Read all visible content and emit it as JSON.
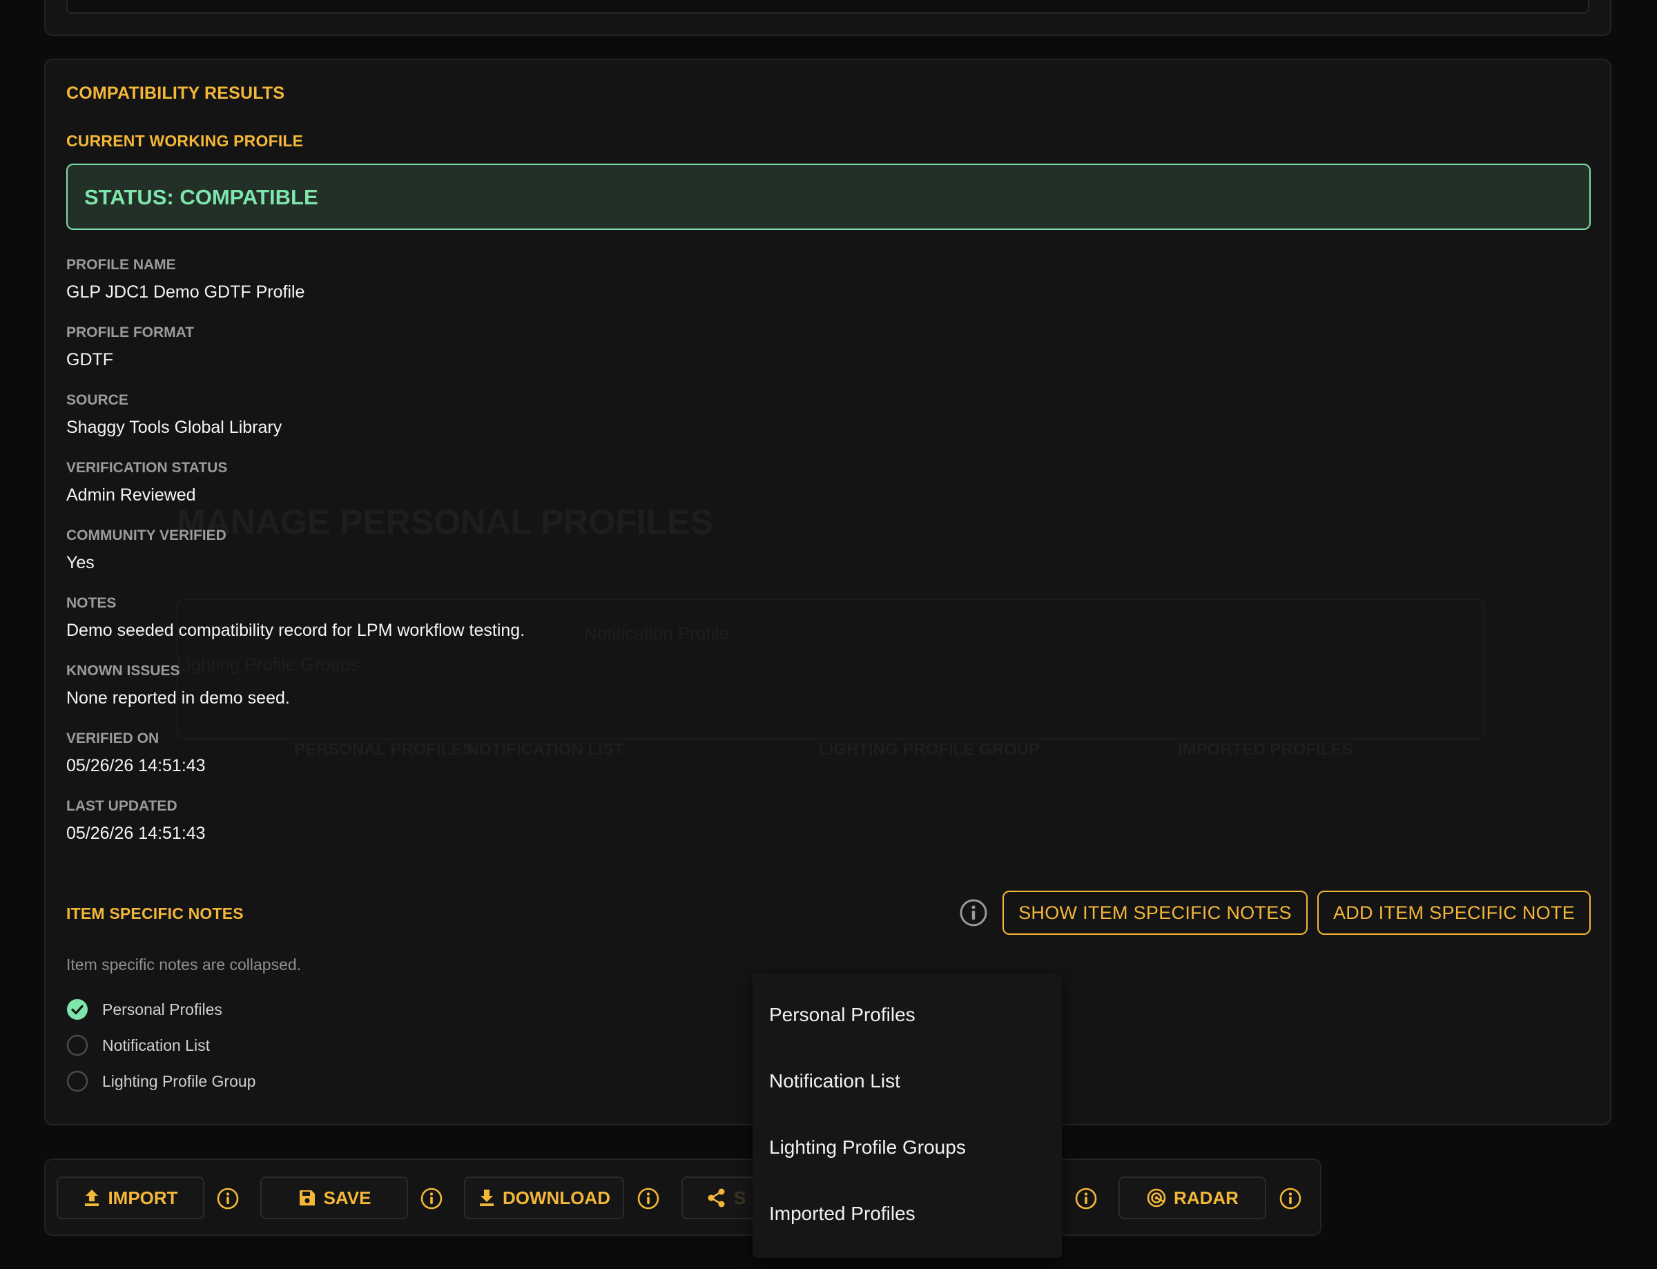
{
  "background_ghost": {
    "title": "MANAGE PERSONAL PROFILES",
    "line1": "Notification Profile",
    "line2": "Lighting Profile Groups",
    "tab1": "PERSONAL PROFILES",
    "tab2": "NOTIFICATION LIST",
    "tab3": "LIGHTING PROFILE GROUP",
    "tab4": "IMPORTED PROFILES"
  },
  "results": {
    "title": "COMPATIBILITY RESULTS",
    "working_profile_label": "CURRENT WORKING PROFILE",
    "status": "STATUS: COMPATIBLE",
    "fields": [
      {
        "label": "PROFILE NAME",
        "value": "GLP JDC1 Demo GDTF Profile"
      },
      {
        "label": "PROFILE FORMAT",
        "value": "GDTF"
      },
      {
        "label": "SOURCE",
        "value": "Shaggy Tools Global Library"
      },
      {
        "label": "VERIFICATION STATUS",
        "value": "Admin Reviewed"
      },
      {
        "label": "COMMUNITY VERIFIED",
        "value": "Yes"
      },
      {
        "label": "NOTES",
        "value": "Demo seeded compatibility record for LPM workflow testing."
      },
      {
        "label": "KNOWN ISSUES",
        "value": "None reported in demo seed."
      },
      {
        "label": "VERIFIED ON",
        "value": "05/26/26 14:51:43"
      },
      {
        "label": "LAST UPDATED",
        "value": "05/26/26 14:51:43"
      }
    ]
  },
  "item_notes": {
    "title": "ITEM SPECIFIC NOTES",
    "show_button": "SHOW ITEM SPECIFIC NOTES",
    "add_button": "ADD ITEM SPECIFIC NOTE",
    "collapsed_text": "Item specific notes are collapsed.",
    "options": [
      {
        "label": "Personal Profiles",
        "checked": true
      },
      {
        "label": "Notification List",
        "checked": false
      },
      {
        "label": "Lighting Profile Group",
        "checked": false
      }
    ]
  },
  "toolbar": {
    "import_label": "IMPORT",
    "save_label": "SAVE",
    "download_label": "DOWNLOAD",
    "share_label": "S",
    "radar_label": "RADAR"
  },
  "dropdown": {
    "items": [
      "Personal Profiles",
      "Notification List",
      "Lighting Profile Groups",
      "Imported Profiles"
    ]
  },
  "colors": {
    "accent": "#f3b739",
    "success": "#7ee6ac",
    "background": "#0b0b0b",
    "card": "#141414"
  }
}
